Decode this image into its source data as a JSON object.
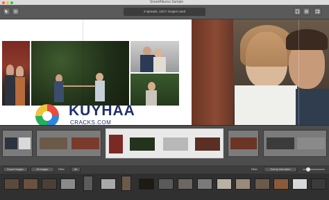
{
  "window": {
    "title": "SmartAlbums Sample",
    "summary": "3 spreads, 15/17 images used"
  },
  "colors": {
    "toolbar_bg": "#5a5a5a",
    "canvas_bg": "#ffffff",
    "strip_bg": "#4d4d4d",
    "selected_spread": "#e9e9e9",
    "brand": "#1f2f6a"
  },
  "toolbar": {
    "left_icons": [
      "select-tool-icon",
      "gear-icon"
    ],
    "right_icons": [
      "single-page-view-icon",
      "list-view-icon",
      "panel-view-icon"
    ]
  },
  "watermark": {
    "brand": "KUYHAA",
    "sub": "CRACKS.COM"
  },
  "bottom_bar": {
    "export_label": "Export Images",
    "source_label": "All Images",
    "filter_label": "Filter",
    "count_value": "All",
    "sort_label": "Filter",
    "sort_value": "Sort by time taken",
    "zoom_fraction": 0.2
  },
  "spreads": [
    {
      "index": 1,
      "selected": false
    },
    {
      "index": 2,
      "selected": false
    },
    {
      "index": 3,
      "selected": true
    },
    {
      "index": 4,
      "selected": false
    },
    {
      "index": 5,
      "selected": false
    }
  ],
  "images_count": 17
}
